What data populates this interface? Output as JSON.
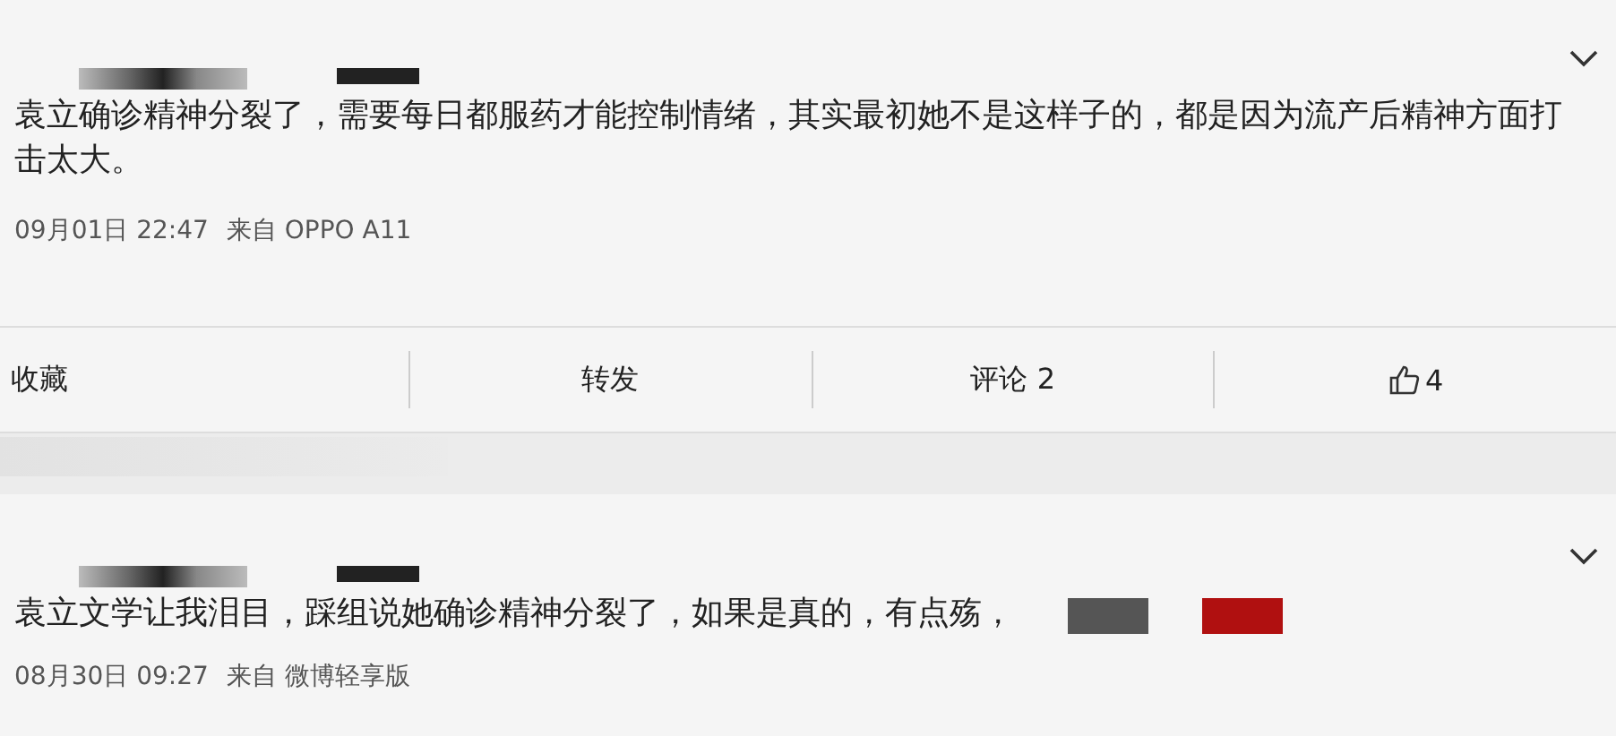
{
  "posts": [
    {
      "body": "袁立确诊精神分裂了，需要每日都服药才能控制情绪，其实最初她不是这样子的，都是因为流产后精神方面打击太大。",
      "time": "09月01日 22:47",
      "source": "来自 OPPO A11",
      "actions": [
        {
          "kind": "text",
          "label": "收藏"
        },
        {
          "kind": "text",
          "label": "转发"
        },
        {
          "kind": "text",
          "label": "评论 2"
        },
        {
          "kind": "like",
          "label": "4"
        }
      ]
    },
    {
      "body": "袁立文学让我泪目，踩组说她确诊精神分裂了，如果是真的，有点殇，",
      "time": "08月30日 09:27",
      "source": "来自 微博轻享版",
      "thumbs": [
        {
          "color": "#555555"
        },
        {
          "color": "#b01010"
        }
      ]
    }
  ]
}
